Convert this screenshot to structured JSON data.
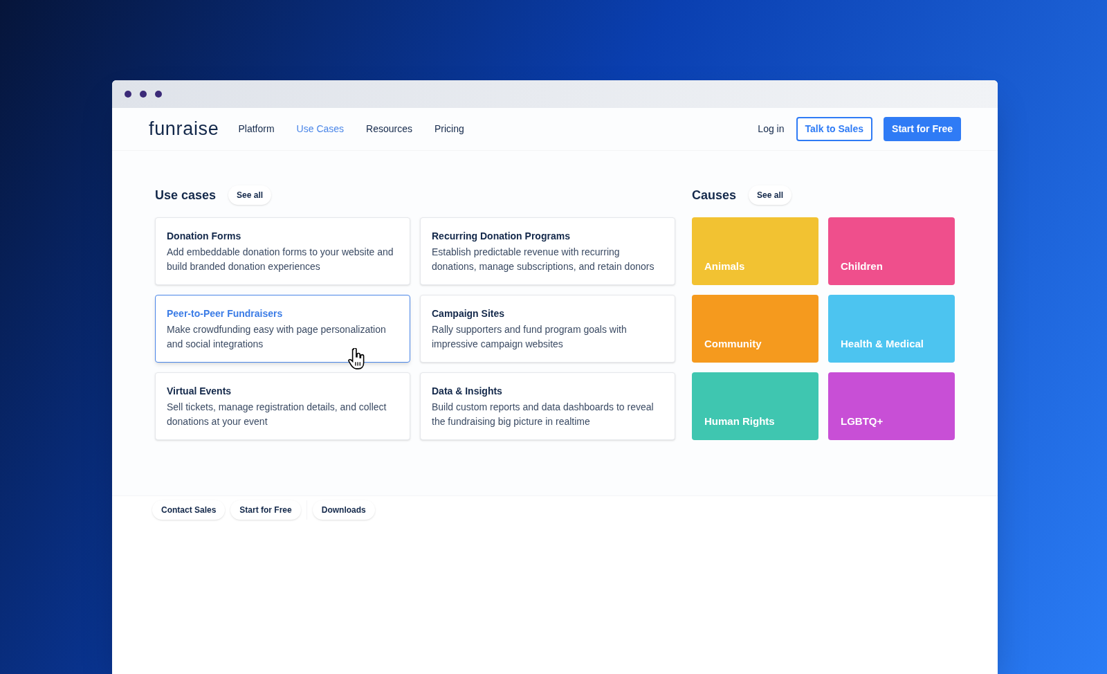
{
  "logo": "funraise",
  "nav": [
    {
      "label": "Platform",
      "selected": false
    },
    {
      "label": "Use Cases",
      "selected": true
    },
    {
      "label": "Resources",
      "selected": false
    },
    {
      "label": "Pricing",
      "selected": false
    }
  ],
  "actions": {
    "login": "Log in",
    "talk": "Talk to Sales",
    "start": "Start for Free"
  },
  "use_cases": {
    "title": "Use cases",
    "see_all": "See all",
    "cards": [
      {
        "title": "Donation Forms",
        "text": "Add embeddable donation forms to your website and build branded donation experiences",
        "selected": false
      },
      {
        "title": "Recurring Donation Programs",
        "text": "Establish predictable revenue with recurring donations, manage subscriptions, and retain donors",
        "selected": false
      },
      {
        "title": "Peer-to-Peer Fundraisers",
        "text": "Make crowdfunding easy with page personalization and social integrations",
        "selected": true
      },
      {
        "title": "Campaign Sites",
        "text": "Rally supporters and fund program goals with impressive campaign websites",
        "selected": false
      },
      {
        "title": "Virtual Events",
        "text": "Sell tickets, manage registration details, and collect donations at your event",
        "selected": false
      },
      {
        "title": "Data & Insights",
        "text": "Build custom reports and data dashboards to reveal the fundraising big picture in realtime",
        "selected": false
      }
    ]
  },
  "causes": {
    "title": "Causes",
    "see_all": "See all",
    "tiles": [
      {
        "label": "Animals",
        "color": "#f2c232"
      },
      {
        "label": "Children",
        "color": "#ef4f8c"
      },
      {
        "label": "Community",
        "color": "#f59a1e"
      },
      {
        "label": "Health & Medical",
        "color": "#4cc4f0"
      },
      {
        "label": "Human Rights",
        "color": "#3fc6b0"
      },
      {
        "label": "LGBTQ+",
        "color": "#c84fd6"
      }
    ]
  },
  "footer": {
    "links": [
      "Contact Sales",
      "Start for Free"
    ],
    "extra": "Downloads"
  }
}
